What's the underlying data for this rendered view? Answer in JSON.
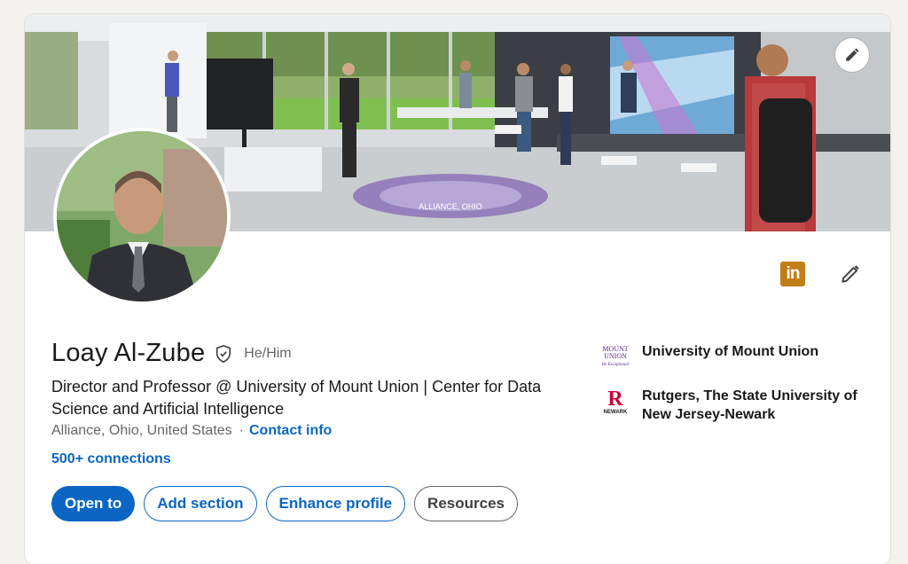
{
  "profile": {
    "name": "Loay Al-Zube",
    "pronouns": "He/Him",
    "headline": "Director and Professor @ University of Mount Union | Center for Data Science and Artificial Intelligence",
    "location": "Alliance, Ohio, United States",
    "separator": "·",
    "contact_label": "Contact info",
    "connections": "500+ connections"
  },
  "banner": {
    "floor_seal_text": "ALLIANCE, OHIO"
  },
  "buttons": {
    "open_to": "Open to",
    "add_section": "Add section",
    "enhance_profile": "Enhance profile",
    "resources": "Resources"
  },
  "organizations": [
    {
      "name": "University of Mount Union",
      "logo_text_line1": "MOUNT",
      "logo_text_line2": "UNION",
      "logo_tagline": "Be Exceptional"
    },
    {
      "name": "Rutgers, The State University of New Jersey-Newark",
      "logo_letter": "R",
      "logo_text": "NEWARK"
    }
  ],
  "icons": {
    "linkedin_logo_text": "in"
  },
  "colors": {
    "accent": "#0a66c2",
    "linkedin_badge": "#c37d16",
    "rutgers_red": "#cc0033",
    "mount_union_purple": "#5b2d82"
  }
}
